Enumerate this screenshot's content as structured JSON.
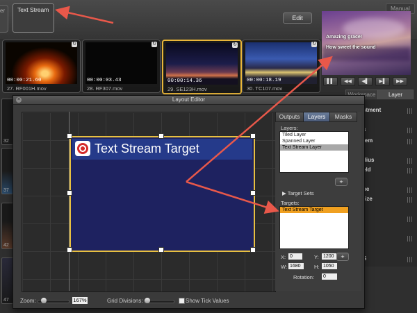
{
  "top": {
    "left_tab_label": "er",
    "text_stream_tab": "Text Stream",
    "edit_button": "Edit",
    "manual_button": "Manual"
  },
  "preview": {
    "line1": "Amazing grace!",
    "line2": "How sweet the sound",
    "transport": [
      "▌▌",
      "◀◀",
      "◀▌",
      "▶▌",
      "▶▶"
    ]
  },
  "right_tabs": [
    "Workspace",
    "Layer"
  ],
  "thumbnails": [
    {
      "timecode": "00:00:21.60",
      "file": "27. RF001H.mov"
    },
    {
      "timecode": "00:00:03.43",
      "file": "28. RF307.mov"
    },
    {
      "timecode": "00:00:14.36",
      "file": "29. SE123H.mov"
    },
    {
      "timecode": "00:00:18.19",
      "file": "30. TC107.mov"
    }
  ],
  "left_thumbs": [
    "32",
    "37",
    "42",
    "47"
  ],
  "right_list": [
    "stment",
    "s",
    "tem",
    "dius",
    "eld",
    "pe",
    "rize",
    "S"
  ],
  "editor": {
    "title": "Layout Editor",
    "target_text": "Text Stream Target",
    "zoom_label": "Zoom:",
    "zoom_value": "167%",
    "grid_label": "Grid Divisions:",
    "show_tick_label": "Show Tick Values"
  },
  "panel": {
    "tabs": [
      "Outputs",
      "Layers",
      "Masks"
    ],
    "active_tab": "Layers",
    "layers_label": "Layers:",
    "layers": [
      "Tiled Layer",
      "Spanned Layer",
      "Text Stream Layer"
    ],
    "target_sets": "Target Sets",
    "targets_label": "Targets:",
    "targets": [
      "Text Stream Target"
    ],
    "plus": "+",
    "x_label": "X:",
    "x_value": "0",
    "y_label": "Y:",
    "y_value": "1200",
    "w_label": "W:",
    "w_value": "1680",
    "h_label": "H:",
    "h_value": "1050",
    "rotation_label": "Rotation:",
    "rotation_value": "0"
  },
  "colors": {
    "selection_border": "#e9b63a",
    "target_fill": "#1e2260",
    "arrow": "#e8584a",
    "target_highlight": "#f0a020"
  }
}
